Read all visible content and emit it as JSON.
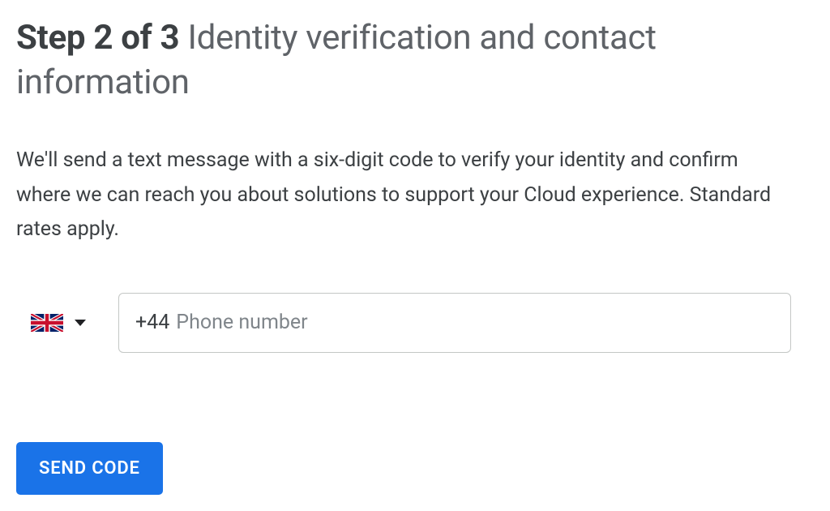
{
  "heading": {
    "step_label": "Step 2 of 3",
    "title": "Identity verification and contact information"
  },
  "description": "We'll send a text message with a six-digit code to verify your identity and confirm where we can reach you about solutions to support your Cloud experience. Standard rates apply.",
  "phone": {
    "country": "United Kingdom",
    "dial_code": "+44",
    "placeholder": "Phone number",
    "value": ""
  },
  "actions": {
    "send_code_label": "SEND CODE"
  }
}
